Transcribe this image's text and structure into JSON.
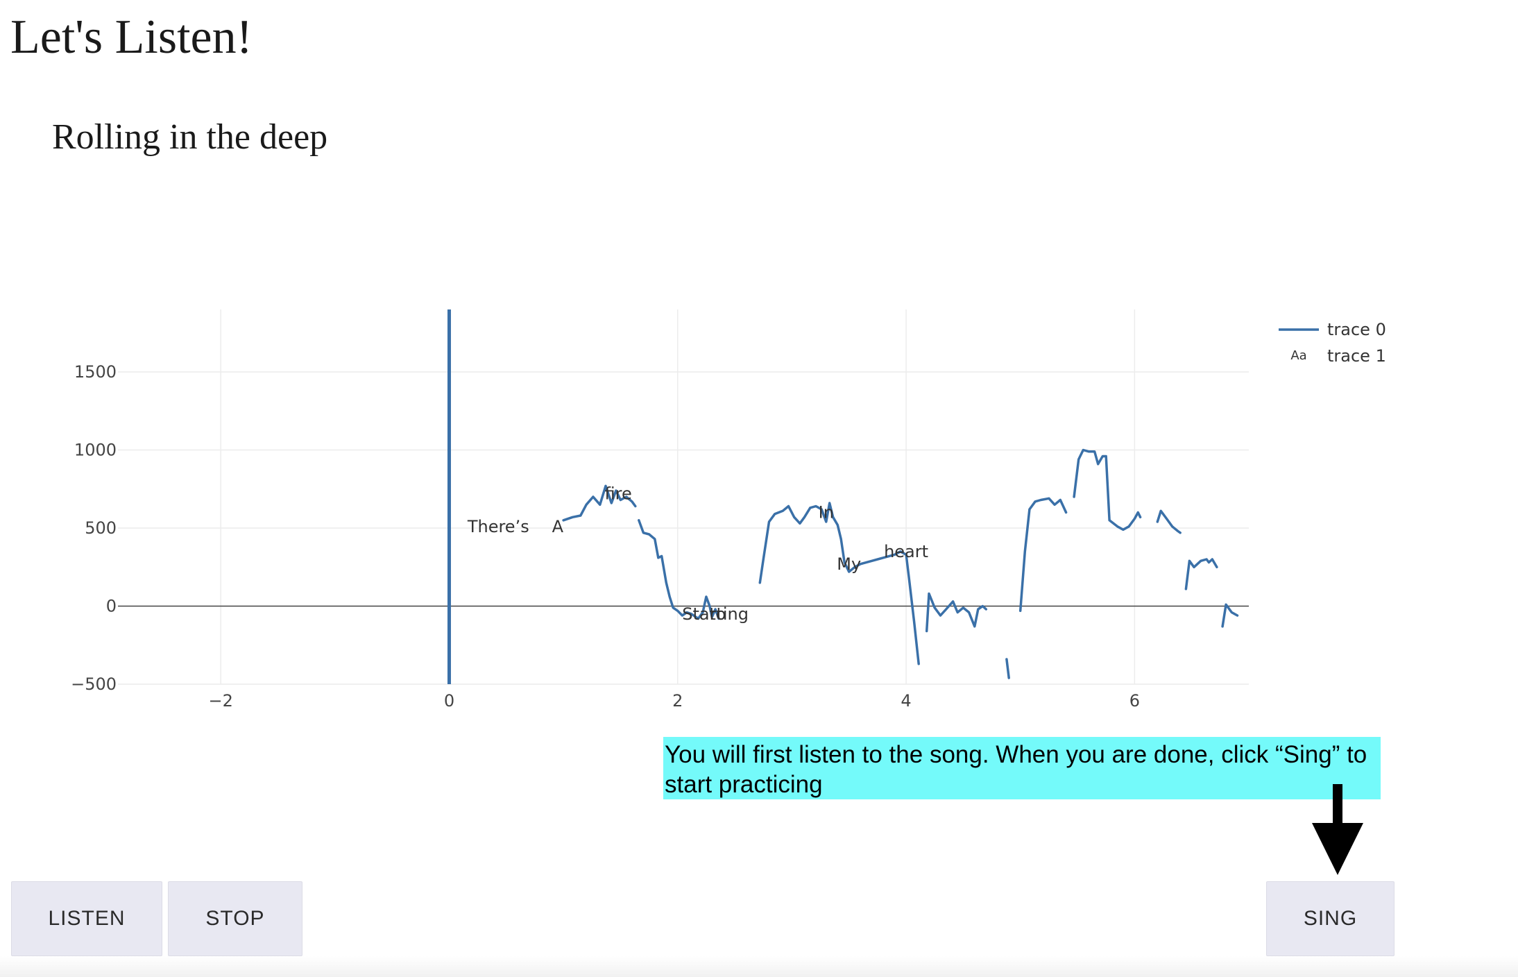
{
  "page": {
    "title": "Let's Listen!",
    "song_title": "Rolling in the deep"
  },
  "instruction": "You will first listen to the song. When you are done, click “Sing” to start practicing",
  "buttons": {
    "listen": "LISTEN",
    "stop": "STOP",
    "sing": "SING"
  },
  "colors": {
    "trace": "#3a70a8",
    "instruction_bg": "#74fafa",
    "button_bg": "#e8e8f2"
  },
  "chart_data": {
    "type": "line",
    "title": "",
    "xlabel": "",
    "ylabel": "",
    "xlim": [
      -2.9,
      7.0
    ],
    "ylim": [
      -500,
      1900
    ],
    "grid": true,
    "legend_position": "top-right",
    "x_ticks": [
      -2,
      0,
      2,
      4,
      6
    ],
    "x_tick_labels": [
      "−2",
      "0",
      "2",
      "4",
      "6"
    ],
    "y_ticks": [
      -500,
      0,
      500,
      1000,
      1500
    ],
    "y_tick_labels": [
      "−500",
      "0",
      "500",
      "1000",
      "1500"
    ],
    "cursor_line": {
      "x": 0,
      "y_range": [
        -500,
        1900
      ]
    },
    "series": [
      {
        "name": "trace 0",
        "kind": "line",
        "segments": [
          [
            [
              1.0,
              550
            ],
            [
              1.08,
              570
            ],
            [
              1.15,
              580
            ],
            [
              1.2,
              650
            ],
            [
              1.26,
              700
            ],
            [
              1.32,
              650
            ],
            [
              1.37,
              770
            ],
            [
              1.42,
              660
            ],
            [
              1.46,
              740
            ],
            [
              1.5,
              680
            ],
            [
              1.55,
              700
            ],
            [
              1.6,
              670
            ],
            [
              1.63,
              640
            ]
          ],
          [
            [
              1.66,
              550
            ],
            [
              1.7,
              470
            ],
            [
              1.75,
              460
            ],
            [
              1.8,
              430
            ],
            [
              1.83,
              310
            ],
            [
              1.86,
              320
            ],
            [
              1.9,
              150
            ],
            [
              1.93,
              60
            ],
            [
              1.96,
              -10
            ],
            [
              2.0,
              -30
            ],
            [
              2.04,
              -60
            ],
            [
              2.08,
              -40
            ],
            [
              2.12,
              -50
            ],
            [
              2.18,
              -80
            ],
            [
              2.22,
              -40
            ],
            [
              2.25,
              60
            ],
            [
              2.28,
              0
            ],
            [
              2.3,
              -70
            ],
            [
              2.33,
              -20
            ],
            [
              2.36,
              -80
            ]
          ],
          [
            [
              2.72,
              150
            ],
            [
              2.75,
              300
            ],
            [
              2.8,
              540
            ],
            [
              2.85,
              590
            ],
            [
              2.92,
              610
            ],
            [
              2.97,
              640
            ],
            [
              3.02,
              570
            ],
            [
              3.07,
              530
            ],
            [
              3.11,
              570
            ],
            [
              3.16,
              630
            ],
            [
              3.21,
              640
            ],
            [
              3.26,
              620
            ],
            [
              3.3,
              540
            ],
            [
              3.33,
              660
            ],
            [
              3.36,
              570
            ],
            [
              3.4,
              520
            ],
            [
              3.43,
              430
            ],
            [
              3.46,
              280
            ],
            [
              3.5,
              220
            ],
            [
              3.55,
              250
            ],
            [
              3.6,
              270
            ],
            [
              3.7,
              290
            ],
            [
              3.8,
              310
            ],
            [
              3.9,
              330
            ],
            [
              3.95,
              350
            ],
            [
              4.0,
              330
            ],
            [
              4.03,
              150
            ],
            [
              4.07,
              -100
            ],
            [
              4.11,
              -370
            ]
          ],
          [
            [
              4.18,
              -160
            ],
            [
              4.2,
              80
            ],
            [
              4.25,
              -10
            ],
            [
              4.3,
              -60
            ],
            [
              4.35,
              -20
            ],
            [
              4.41,
              30
            ],
            [
              4.45,
              -40
            ],
            [
              4.5,
              -10
            ],
            [
              4.55,
              -40
            ],
            [
              4.6,
              -130
            ],
            [
              4.63,
              -20
            ],
            [
              4.67,
              0
            ],
            [
              4.7,
              -20
            ]
          ],
          [
            [
              4.88,
              -340
            ],
            [
              4.9,
              -460
            ]
          ],
          [
            [
              5.0,
              -30
            ],
            [
              5.04,
              350
            ],
            [
              5.08,
              620
            ],
            [
              5.13,
              670
            ],
            [
              5.18,
              680
            ],
            [
              5.25,
              690
            ],
            [
              5.3,
              650
            ],
            [
              5.35,
              680
            ],
            [
              5.4,
              600
            ]
          ],
          [
            [
              5.47,
              700
            ],
            [
              5.51,
              940
            ],
            [
              5.55,
              1000
            ],
            [
              5.6,
              990
            ],
            [
              5.65,
              990
            ],
            [
              5.68,
              910
            ],
            [
              5.72,
              960
            ],
            [
              5.75,
              960
            ],
            [
              5.78,
              550
            ],
            [
              5.85,
              510
            ],
            [
              5.9,
              490
            ],
            [
              5.95,
              510
            ],
            [
              6.0,
              560
            ],
            [
              6.03,
              600
            ],
            [
              6.05,
              570
            ]
          ],
          [
            [
              6.2,
              540
            ],
            [
              6.23,
              610
            ],
            [
              6.28,
              560
            ],
            [
              6.33,
              510
            ],
            [
              6.38,
              480
            ],
            [
              6.4,
              470
            ]
          ],
          [
            [
              6.45,
              110
            ],
            [
              6.48,
              290
            ],
            [
              6.52,
              250
            ],
            [
              6.58,
              290
            ],
            [
              6.63,
              300
            ],
            [
              6.65,
              280
            ],
            [
              6.68,
              300
            ],
            [
              6.72,
              250
            ]
          ],
          [
            [
              6.77,
              -130
            ],
            [
              6.8,
              10
            ],
            [
              6.85,
              -40
            ],
            [
              6.9,
              -60
            ]
          ]
        ]
      },
      {
        "name": "trace 1",
        "kind": "text",
        "points": [
          {
            "x": 0.43,
            "y": 510,
            "text": "There’s"
          },
          {
            "x": 0.95,
            "y": 510,
            "text": "A"
          },
          {
            "x": 1.48,
            "y": 720,
            "text": "fire"
          },
          {
            "x": 3.3,
            "y": 600,
            "text": "In"
          },
          {
            "x": 3.5,
            "y": 270,
            "text": "My"
          },
          {
            "x": 4.0,
            "y": 350,
            "text": "heart"
          },
          {
            "x": 2.33,
            "y": -50,
            "text": "Starting"
          },
          {
            "x": 2.35,
            "y": -50,
            "text": "to"
          }
        ]
      }
    ]
  }
}
